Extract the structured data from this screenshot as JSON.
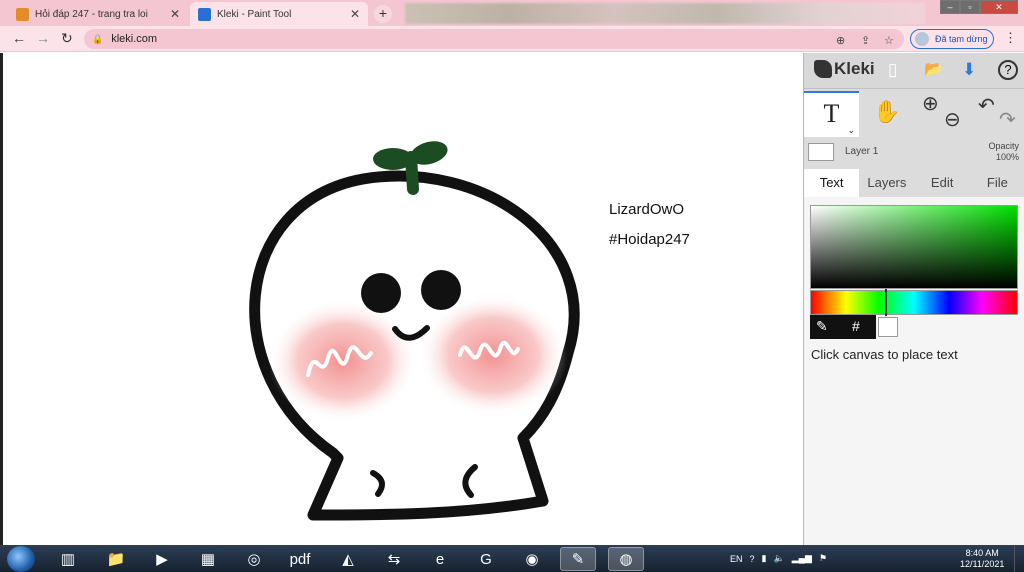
{
  "browser": {
    "tabs": [
      {
        "title": "Hỏi đáp 247 - trang tra loi",
        "favicon_color": "#e58c2a",
        "close": "✕"
      },
      {
        "title": "Kleki - Paint Tool",
        "favicon_color": "#2a6fd6",
        "close": "✕"
      }
    ],
    "new_tab": "+",
    "window_controls": {
      "minimize": "–",
      "maximize": "▫",
      "close": "✕"
    },
    "nav": {
      "back": "←",
      "forward": "→",
      "reload": "↻"
    },
    "url": "kleki.com",
    "profile_status": "Đã tạm dừng",
    "menu": "⋮"
  },
  "canvas": {
    "texts": {
      "line1": "LizardOwO",
      "line2": "#Hoidap247"
    },
    "colors": {
      "outline": "#111111",
      "leaf": "#1c4d22",
      "blush": "#f28a8a",
      "squiggle": "#ffffff"
    }
  },
  "kleki": {
    "logo": "Kleki",
    "header_icons": {
      "new": "▯",
      "open": "📂",
      "download": "⬇",
      "help": "?"
    },
    "tools": {
      "text": "T",
      "text_caret": "⌄",
      "hand": "✋",
      "zoom_in": "⊕",
      "zoom_out": "⊖",
      "undo": "↶",
      "redo": "↷"
    },
    "layer": {
      "name": "Layer 1",
      "opacity_label": "Opacity",
      "opacity_value": "100%"
    },
    "tabs": [
      "Text",
      "Layers",
      "Edit",
      "File"
    ],
    "active_tab": "Text",
    "color": {
      "eyedropper": "✎",
      "hex_button": "#",
      "current": "#ffffff"
    },
    "hint": "Click canvas to place text"
  },
  "taskbar": {
    "apps": [
      {
        "name": "explorer-app",
        "glyph": "▥"
      },
      {
        "name": "folder-app",
        "glyph": "📁"
      },
      {
        "name": "media-app",
        "glyph": "▶"
      },
      {
        "name": "calculator-app",
        "glyph": "▦"
      },
      {
        "name": "greenshot-app",
        "glyph": "◎"
      },
      {
        "name": "pdf-app",
        "glyph": "pdf"
      },
      {
        "name": "acrobat-app",
        "glyph": "◭"
      },
      {
        "name": "teamviewer-app",
        "glyph": "⇆"
      },
      {
        "name": "ie-app",
        "glyph": "e"
      },
      {
        "name": "foxit-app",
        "glyph": "G"
      },
      {
        "name": "zoom-app",
        "glyph": "◉"
      },
      {
        "name": "paint-app",
        "glyph": "✎"
      },
      {
        "name": "chrome-app",
        "glyph": "◍"
      }
    ],
    "language": "EN",
    "time": "8:40 AM",
    "date": "12/11/2021"
  }
}
